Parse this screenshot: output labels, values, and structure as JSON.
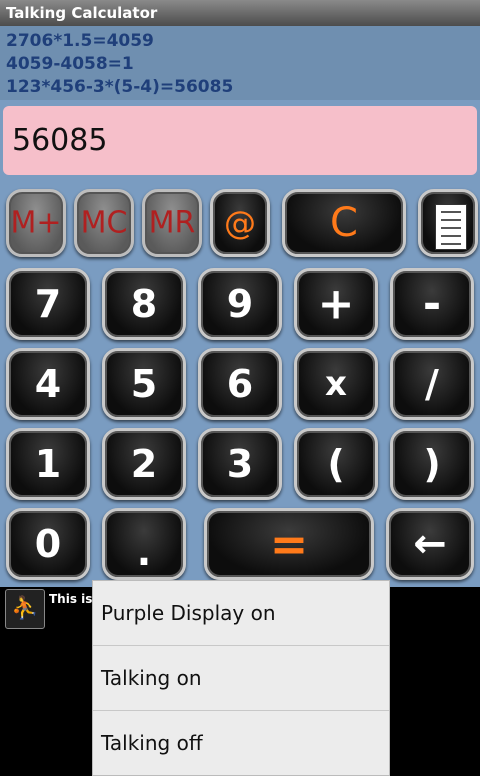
{
  "window": {
    "title": "Talking Calculator"
  },
  "history": [
    "2706*1.5=4059",
    "4059-4058=1",
    "123*456-3*(5-4)=56085"
  ],
  "display": {
    "value": "56085"
  },
  "memory_keys": {
    "mplus": "M+",
    "mc": "MC",
    "mr": "MR",
    "at": "@",
    "clear": "C"
  },
  "keys": {
    "k7": "7",
    "k8": "8",
    "k9": "9",
    "plus": "+",
    "minus": "-",
    "k4": "4",
    "k5": "5",
    "k6": "6",
    "times": "x",
    "divide": "/",
    "k1": "1",
    "k2": "2",
    "k3": "3",
    "lparen": "(",
    "rparen": ")",
    "k0": "0",
    "dot": ".",
    "equals": "=",
    "back": "←"
  },
  "ad": {
    "text": "This is a test ad"
  },
  "menu": {
    "items": [
      "Purple Display on",
      "Talking on",
      "Talking off"
    ]
  },
  "colors": {
    "accent": "#ff7a1a",
    "display_bg": "#f6bfca",
    "panel_bg": "#7a9cc1"
  },
  "icons": [
    "document-icon",
    "ad-figure-icon",
    "backspace-arrow-icon"
  ]
}
